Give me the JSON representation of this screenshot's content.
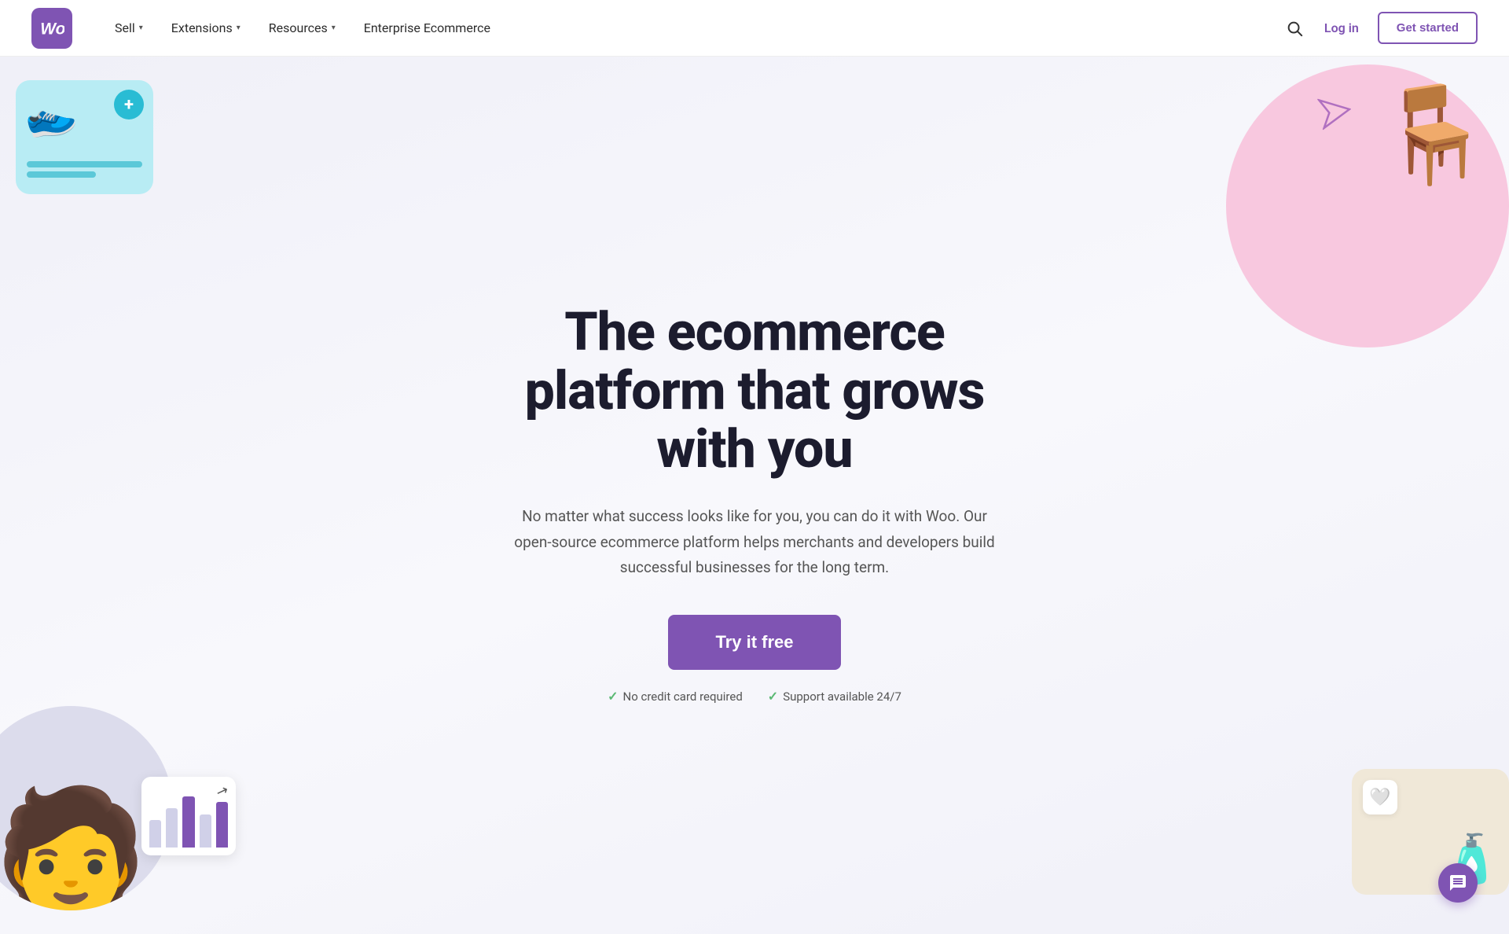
{
  "navbar": {
    "logo_text": "Woo",
    "nav_items": [
      {
        "label": "Sell",
        "has_dropdown": true
      },
      {
        "label": "Extensions",
        "has_dropdown": true
      },
      {
        "label": "Resources",
        "has_dropdown": true
      },
      {
        "label": "Enterprise Ecommerce",
        "has_dropdown": false
      }
    ],
    "login_label": "Log in",
    "get_started_label": "Get started",
    "search_aria": "Search"
  },
  "hero": {
    "title": "The ecommerce platform that grows with you",
    "subtitle": "No matter what success looks like for you, you can do it with Woo. Our open-source ecommerce platform helps merchants and developers build successful businesses for the long term.",
    "cta_label": "Try it free",
    "perks": [
      {
        "label": "No credit card required"
      },
      {
        "label": "Support available 24/7"
      }
    ]
  },
  "colors": {
    "brand_purple": "#7f54b3",
    "teal": "#29bcd4",
    "light_blue": "#b8ecf4",
    "pink": "#f8c8df",
    "check_green": "#5bb974"
  }
}
